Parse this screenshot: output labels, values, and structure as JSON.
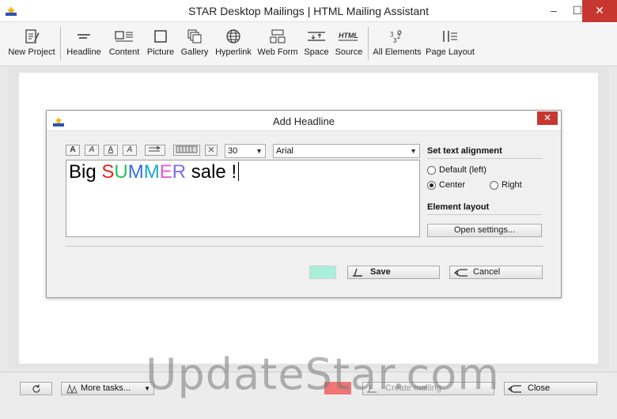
{
  "window": {
    "title": "STAR Desktop Mailings | HTML Mailing Assistant",
    "controls": {
      "minimize": "–",
      "maximize": "☐",
      "close": "✕"
    }
  },
  "toolbar": {
    "items": [
      {
        "label": "New Project",
        "icon": "new-project-icon"
      },
      {
        "label": "Headline",
        "icon": "headline-icon"
      },
      {
        "label": "Content",
        "icon": "content-icon"
      },
      {
        "label": "Picture",
        "icon": "picture-icon"
      },
      {
        "label": "Gallery",
        "icon": "gallery-icon"
      },
      {
        "label": "Hyperlink",
        "icon": "globe-icon"
      },
      {
        "label": "Web Form",
        "icon": "web-form-icon"
      },
      {
        "label": "Space",
        "icon": "space-icon"
      },
      {
        "label": "Source",
        "icon": "html-source-icon"
      },
      {
        "label": "All Elements",
        "icon": "all-elements-icon"
      },
      {
        "label": "Page Layout",
        "icon": "page-layout-icon"
      }
    ]
  },
  "dialog": {
    "title": "Add Headline",
    "close": "✕",
    "format_buttons": [
      "A",
      "A",
      "A",
      "A"
    ],
    "font_size": "30",
    "font_family": "Arial",
    "headline": {
      "parts": [
        {
          "text": "Big ",
          "color": "#000000"
        },
        {
          "text": "S",
          "color": "#e8231d"
        },
        {
          "text": "U",
          "color": "#27c35a"
        },
        {
          "text": "M",
          "color": "#2f6fe4"
        },
        {
          "text": "M",
          "color": "#17a6d6"
        },
        {
          "text": "E",
          "color": "#e45ad6"
        },
        {
          "text": "R",
          "color": "#7a6ff0"
        },
        {
          "text": " sale !",
          "color": "#000000"
        }
      ]
    },
    "alignment_title": "Set text alignment",
    "alignment_options": [
      {
        "label": "Default (left)",
        "selected": false
      },
      {
        "label": "Center",
        "selected": true
      },
      {
        "label": "Right",
        "selected": false
      }
    ],
    "layout_title": "Element layout",
    "open_settings": "Open settings...",
    "save": "Save",
    "cancel": "Cancel",
    "color_swatch": "#a9f0da"
  },
  "bottombar": {
    "more_tasks": "More tasks...",
    "create_mailing": "Create mailing",
    "close": "Close",
    "color_swatch": "#f07575"
  },
  "watermark": "UpdateStar.com"
}
